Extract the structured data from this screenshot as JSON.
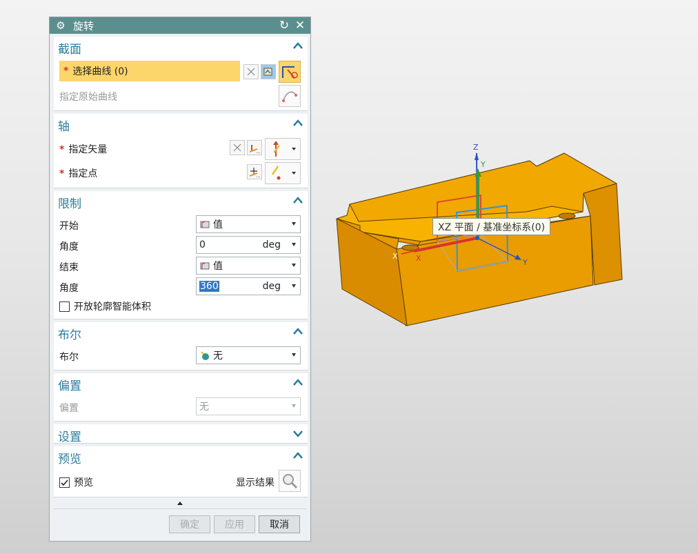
{
  "dialog": {
    "title": "旋转",
    "sections": {
      "section": {
        "header": "截面",
        "select_curve": "选择曲线 (0)",
        "specify_original": "指定原始曲线"
      },
      "axis": {
        "header": "轴",
        "specify_vector": "指定矢量",
        "specify_point": "指定点"
      },
      "limits": {
        "header": "限制",
        "start_label": "开始",
        "start_value": "值",
        "start_angle_label": "角度",
        "start_angle": "0",
        "end_label": "结束",
        "end_value": "值",
        "end_angle_label": "角度",
        "end_angle": "360",
        "unit": "deg",
        "open_profile": "开放轮廓智能体积"
      },
      "boolean": {
        "header": "布尔",
        "label": "布尔",
        "value": "无"
      },
      "offset": {
        "header": "偏置",
        "label": "偏置",
        "value": "无"
      },
      "settings": {
        "header": "设置"
      },
      "preview": {
        "header": "预览",
        "checkbox_label": "预览",
        "show_result": "显示结果"
      }
    },
    "buttons": {
      "ok": "确定",
      "apply": "应用",
      "cancel": "取消"
    }
  },
  "viewport": {
    "tooltip": "XZ 平面 / 基准坐标系(0)",
    "axes": {
      "x": "X",
      "y": "Y",
      "z": "Z"
    },
    "colors": {
      "part": "#f0a500",
      "part_dark": "#d88a00",
      "x_axis": "#d8342b",
      "y_axis": "#2f4fc8",
      "z_axis": "#2f4fc8",
      "y_green": "#3a9a3a"
    }
  }
}
